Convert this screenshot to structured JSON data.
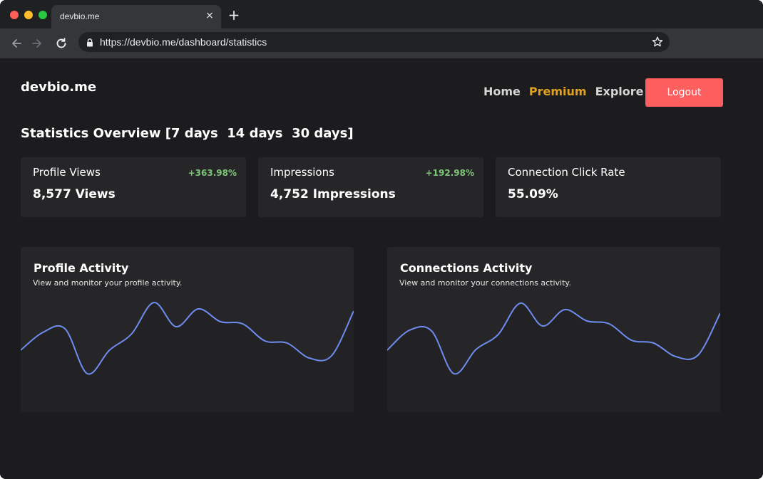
{
  "browser": {
    "tab_title": "devbio.me",
    "close_glyph": "×",
    "new_tab_glyph": "+",
    "url": "https://devbio.me/dashboard/statistics"
  },
  "header": {
    "brand": "devbio.me",
    "nav": [
      {
        "label": "Home"
      },
      {
        "label": "Premium"
      },
      {
        "label": "Explore"
      }
    ],
    "logout_label": "Logout"
  },
  "overview": {
    "title": "Statistics Overview",
    "open_bracket": "[",
    "ranges": [
      "7 days",
      "14 days",
      "30 days"
    ],
    "close_bracket": "]"
  },
  "stats": [
    {
      "label": "Profile Views",
      "value": "8,577 Views",
      "change": "+363.98%"
    },
    {
      "label": "Impressions",
      "value": "4,752 Impressions",
      "change": "+192.98%"
    },
    {
      "label": "Connection Click Rate",
      "value": "55.09%",
      "change": ""
    }
  ],
  "activity": [
    {
      "title": "Profile Activity",
      "subtitle": "View and monitor your profile activity."
    },
    {
      "title": "Connections Activity",
      "subtitle": "View and monitor your connections activity."
    }
  ],
  "colors": {
    "accent_premium": "#e0a21f",
    "logout": "#fd5f5f",
    "positive": "#7cc576",
    "line": "#6f8cf0"
  },
  "chart_data": [
    {
      "type": "line",
      "series": [
        {
          "values": [
            0.15,
            0.4,
            0.45,
            -0.18,
            0.15,
            0.38,
            0.82,
            0.48,
            0.73,
            0.55,
            0.52,
            0.28,
            0.25,
            0.04,
            0.07,
            0.7
          ]
        }
      ],
      "ylim": [
        -0.4,
        1.0
      ],
      "grid": false
    },
    {
      "type": "line",
      "series": [
        {
          "values": [
            0.15,
            0.43,
            0.42,
            -0.18,
            0.16,
            0.37,
            0.81,
            0.49,
            0.72,
            0.56,
            0.52,
            0.29,
            0.25,
            0.06,
            0.08,
            0.67
          ]
        }
      ],
      "ylim": [
        -0.4,
        1.0
      ],
      "grid": false
    }
  ]
}
